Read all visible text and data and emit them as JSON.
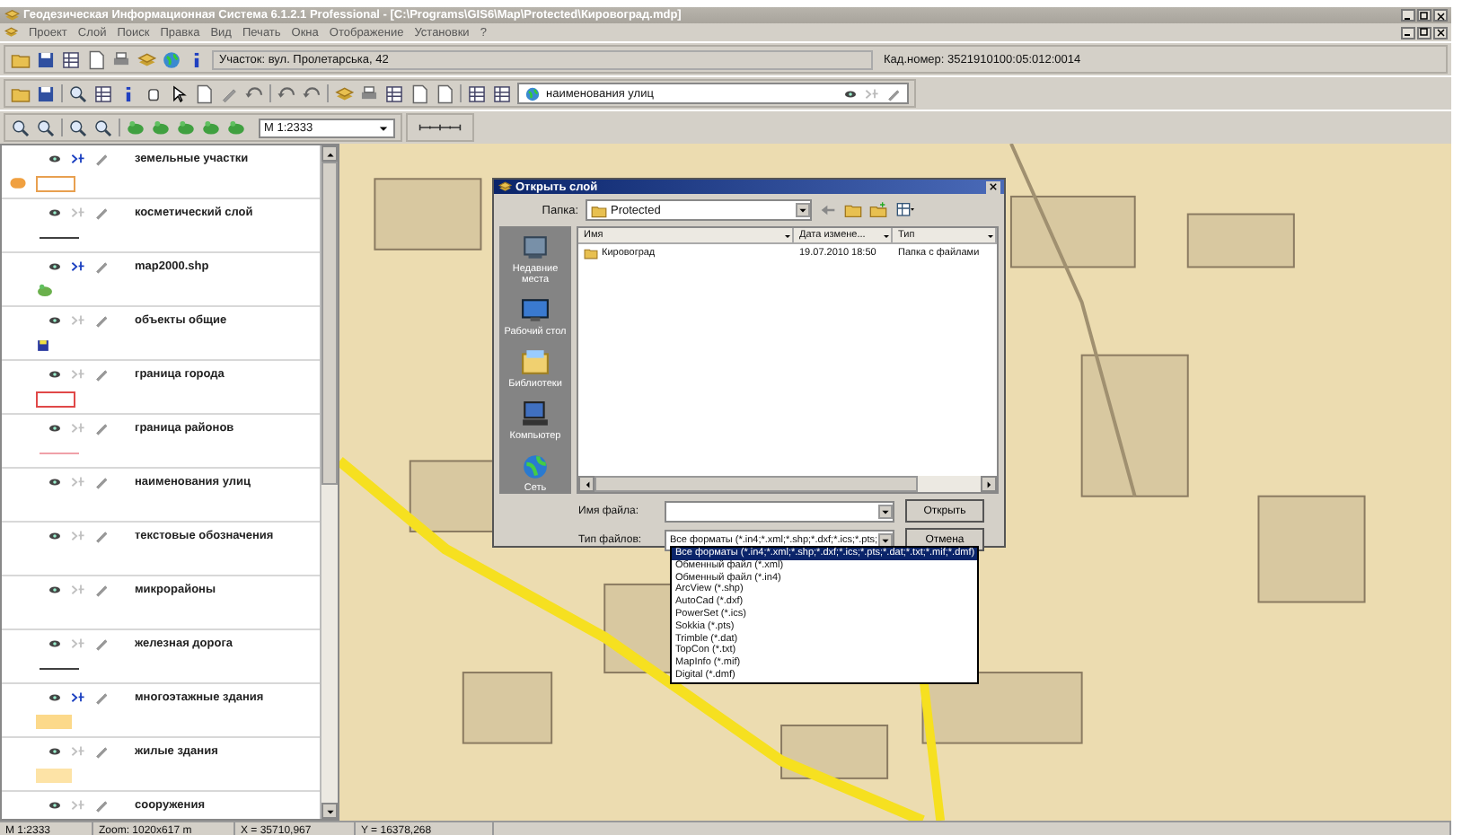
{
  "window": {
    "title": "Геодезическая Информационная Система 6.1.2.1 Professional - [C:\\Programs\\GIS6\\Map\\Protected\\Кировоград.mdp]"
  },
  "menu": [
    "Проект",
    "Слой",
    "Поиск",
    "Правка",
    "Вид",
    "Печать",
    "Окна",
    "Отображение",
    "Установки",
    "?"
  ],
  "toolbar": {
    "parcel": "Участок: вул. Пролетарська, 42",
    "cadastral": "Кад.номер: 3521910100:05:012:0014",
    "active_layer": "наименования улиц",
    "scale": "М 1:2333"
  },
  "layers": [
    {
      "name": "земельные участки",
      "selectable": true,
      "kind": "outline",
      "color": "#e8a050",
      "labeled": true
    },
    {
      "name": "косметический слой",
      "selectable": false,
      "kind": "line",
      "color": "#404040",
      "labeled": false
    },
    {
      "name": "map2000.shp",
      "selectable": true,
      "kind": "image",
      "color": "#6ab04c",
      "labeled": false
    },
    {
      "name": "объекты общие",
      "selectable": false,
      "kind": "marker",
      "color": "#2a3aa0",
      "labeled": false
    },
    {
      "name": "граница города",
      "selectable": false,
      "kind": "outline",
      "color": "#e04848",
      "labeled": false
    },
    {
      "name": "граница районов",
      "selectable": false,
      "kind": "line",
      "color": "#f0a0a8",
      "labeled": false
    },
    {
      "name": "наименования улиц",
      "selectable": false,
      "kind": "none",
      "labeled": false
    },
    {
      "name": "текстовые обозначения",
      "selectable": false,
      "kind": "none",
      "labeled": false
    },
    {
      "name": "микрорайоны",
      "selectable": false,
      "kind": "none",
      "labeled": false
    },
    {
      "name": "железная дорога",
      "selectable": false,
      "kind": "line",
      "color": "#404040",
      "labeled": false
    },
    {
      "name": "многоэтажные здания",
      "selectable": true,
      "kind": "fill",
      "color": "#fcd98a",
      "labeled": false
    },
    {
      "name": "жилые здания",
      "selectable": false,
      "kind": "fill",
      "color": "#fde3a6",
      "labeled": false
    },
    {
      "name": "сооружения",
      "selectable": false,
      "kind": "none",
      "labeled": false
    }
  ],
  "dialog": {
    "title": "Открыть слой",
    "folder_label": "Папка:",
    "folder": "Protected",
    "columns": [
      "Имя",
      "Дата измене...",
      "Тип"
    ],
    "files": [
      {
        "name": "Кировоград",
        "date": "19.07.2010 18:50",
        "type": "Папка с файлами"
      }
    ],
    "places": [
      "Недавние места",
      "Рабочий стол",
      "Библиотеки",
      "Компьютер",
      "Сеть"
    ],
    "filename_label": "Имя файла:",
    "filetype_label": "Тип файлов:",
    "filetype": "Все форматы (*.in4;*.xml;*.shp;*.dxf;*.ics;*.pts;",
    "buttons": [
      "Открыть",
      "Отмена"
    ],
    "filetype_options": [
      {
        "label": "Все форматы (*.in4;*.xml;*.shp;*.dxf;*.ics;*.pts;*.dat;*.txt;*.mif;*.dmf)",
        "selected": true
      },
      {
        "label": "Обменный файл (*.xml)",
        "selected": false
      },
      {
        "label": "Обменный файл (*.in4)",
        "selected": false
      },
      {
        "label": "ArcView (*.shp)",
        "selected": false
      },
      {
        "label": "AutoCad (*.dxf)",
        "selected": false
      },
      {
        "label": "PowerSet (*.ics)",
        "selected": false
      },
      {
        "label": "Sokkia (*.pts)",
        "selected": false
      },
      {
        "label": "Trimble (*.dat)",
        "selected": false
      },
      {
        "label": "TopCon (*.txt)",
        "selected": false
      },
      {
        "label": "MapInfo (*.mif)",
        "selected": false
      },
      {
        "label": "Digital (*.dmf)",
        "selected": false
      }
    ]
  },
  "status_bar": [
    "М 1:2333",
    "Zoom: 1020x617 m",
    "X = 35710,967",
    "Y = 16378,268"
  ]
}
